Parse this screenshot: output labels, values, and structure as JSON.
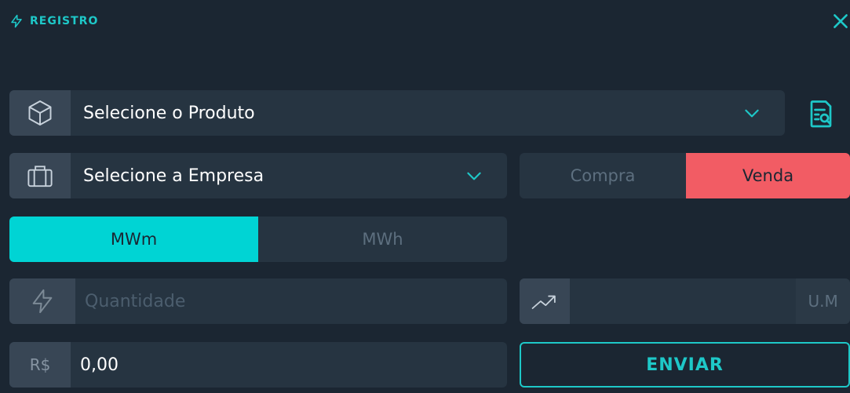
{
  "header": {
    "title": "REGISTRO",
    "bolt_icon": "bolt-icon",
    "close_icon": "close-icon"
  },
  "product": {
    "placeholder": "Selecione o Produto",
    "icon": "box-icon"
  },
  "search_doc_icon": "document-search-icon",
  "company": {
    "placeholder": "Selecione a Empresa",
    "icon": "briefcase-icon"
  },
  "side": {
    "buy_label": "Compra",
    "sell_label": "Venda",
    "selected": "Venda"
  },
  "unit": {
    "mwm_label": "MWm",
    "mwh_label": "MWh",
    "selected": "MWm"
  },
  "quantity": {
    "placeholder": "Quantidade",
    "icon": "bolt-icon"
  },
  "price_index": {
    "icon": "trend-up-icon",
    "value": "",
    "suffix": "U.M"
  },
  "price": {
    "prefix": "R$",
    "value": "0,00"
  },
  "submit": {
    "label": "ENVIAR"
  },
  "colors": {
    "accent": "#1ec8c8",
    "sell_active": "#f25c64",
    "unit_active": "#00d4d4",
    "background": "#1b2632"
  }
}
